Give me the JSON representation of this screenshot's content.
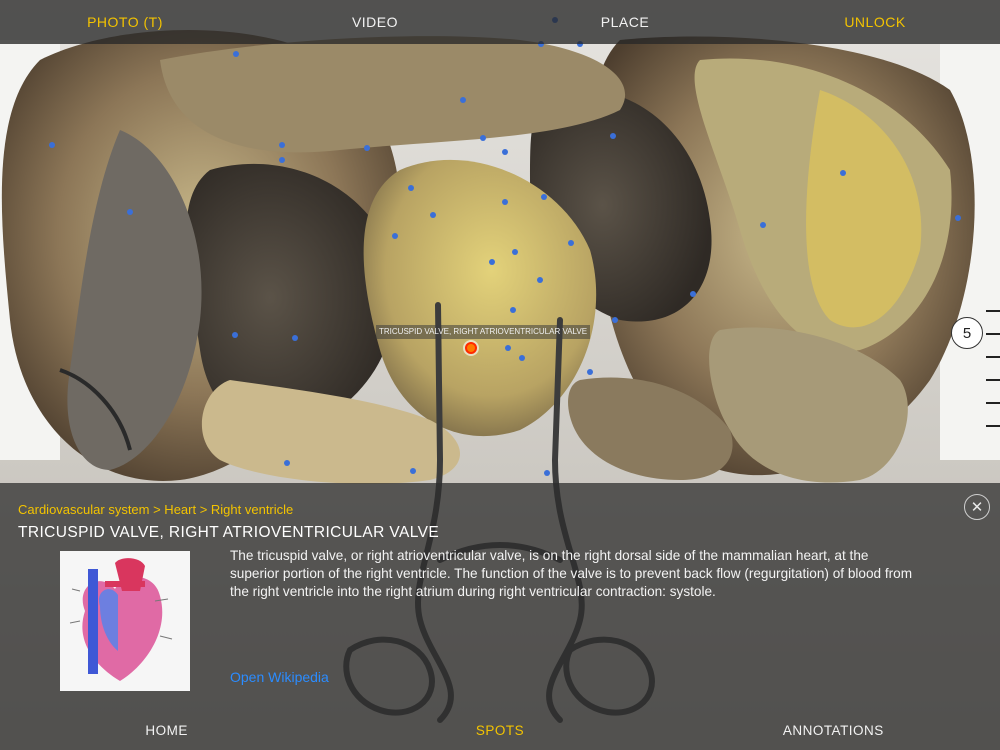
{
  "top_tabs": [
    {
      "label": "PHOTO (T)"
    },
    {
      "label": "VIDEO"
    },
    {
      "label": "PLACE"
    },
    {
      "label": "UNLOCK"
    }
  ],
  "hotspot": {
    "label": "TRICUSPID VALVE, RIGHT ATRIOVENTRICULAR VALVE"
  },
  "level_badge": "5",
  "panel": {
    "breadcrumb": "Cardiovascular system > Heart > Right ventricle",
    "title": "TRICUSPID VALVE, RIGHT ATRIOVENTRICULAR VALVE",
    "description": "The tricuspid valve, or right atrioventricular valve, is on the right dorsal side of the mammalian heart, at the superior portion of the right ventricle. The function of the valve is to prevent back flow (regurgitation) of blood from the right ventricle into the right atrium during right ventricular contraction: systole.",
    "link": "Open Wikipedia"
  },
  "bottom_tabs": [
    {
      "label": "HOME"
    },
    {
      "label": "SPOTS"
    },
    {
      "label": "ANNOTATIONS"
    }
  ],
  "colors": {
    "accent": "#f3c300",
    "link": "#2b8cff",
    "hotspot": "#3a6fd8",
    "active_hotspot": "#ff5a00"
  },
  "icons": {
    "close": "close-icon",
    "heart": "heart-diagram-icon"
  }
}
